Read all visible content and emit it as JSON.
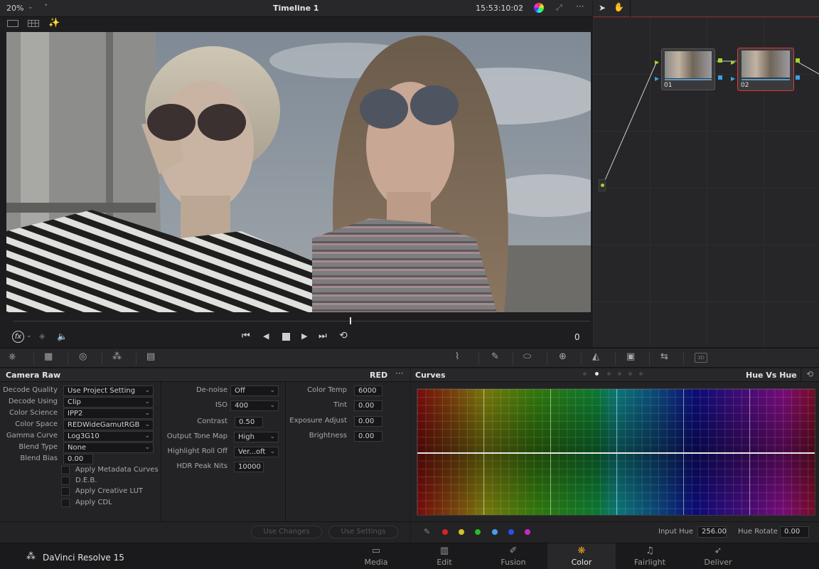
{
  "viewer": {
    "zoom": "20%",
    "timeline_title": "Timeline 1",
    "timecode": "15:53:10:02",
    "frame_counter": "0"
  },
  "nodes": [
    {
      "label": "01"
    },
    {
      "label": "02"
    }
  ],
  "camera_raw": {
    "title": "Camera Raw",
    "format": "RED",
    "decode_quality": {
      "label": "Decode Quality",
      "value": "Use Project Setting"
    },
    "decode_using": {
      "label": "Decode Using",
      "value": "Clip"
    },
    "color_science": {
      "label": "Color Science",
      "value": "IPP2"
    },
    "color_space": {
      "label": "Color Space",
      "value": "REDWideGamutRGB"
    },
    "gamma_curve": {
      "label": "Gamma Curve",
      "value": "Log3G10"
    },
    "blend_type": {
      "label": "Blend Type",
      "value": "None"
    },
    "blend_bias": {
      "label": "Blend Bias",
      "value": "0.00"
    },
    "checkboxes": [
      "Apply Metadata Curves",
      "D.E.B.",
      "Apply Creative LUT",
      "Apply CDL"
    ],
    "denoise": {
      "label": "De-noise",
      "value": "Off"
    },
    "iso": {
      "label": "ISO",
      "value": "400"
    },
    "contrast": {
      "label": "Contrast",
      "value": "0.50"
    },
    "output_tone_map": {
      "label": "Output Tone Map",
      "value": "High"
    },
    "highlight_roll_off": {
      "label": "Highlight Roll Off",
      "value": "Ver...oft"
    },
    "hdr_peak_nits": {
      "label": "HDR Peak Nits",
      "value": "10000"
    },
    "color_temp": {
      "label": "Color Temp",
      "value": "6000"
    },
    "tint": {
      "label": "Tint",
      "value": "0.00"
    },
    "exposure_adjust": {
      "label": "Exposure Adjust",
      "value": "0.00"
    },
    "brightness": {
      "label": "Brightness",
      "value": "0.00"
    },
    "use_changes": "Use Changes",
    "use_settings": "Use Settings"
  },
  "curves": {
    "title": "Curves",
    "mode": "Hue Vs Hue",
    "input_hue_label": "Input Hue",
    "input_hue_value": "256.00",
    "hue_rotate_label": "Hue Rotate",
    "hue_rotate_value": "0.00",
    "swatch_colors": [
      "#d42424",
      "#d4c224",
      "#2cb82c",
      "#4aa0e8",
      "#2a50e8",
      "#c62ac6"
    ]
  },
  "app": {
    "name": "DaVinci Resolve 15"
  },
  "pages": [
    {
      "label": "Media",
      "icon": "media-icon"
    },
    {
      "label": "Edit",
      "icon": "edit-icon"
    },
    {
      "label": "Fusion",
      "icon": "fusion-icon"
    },
    {
      "label": "Color",
      "icon": "color-icon",
      "active": true
    },
    {
      "label": "Fairlight",
      "icon": "fairlight-icon"
    },
    {
      "label": "Deliver",
      "icon": "deliver-icon"
    }
  ]
}
